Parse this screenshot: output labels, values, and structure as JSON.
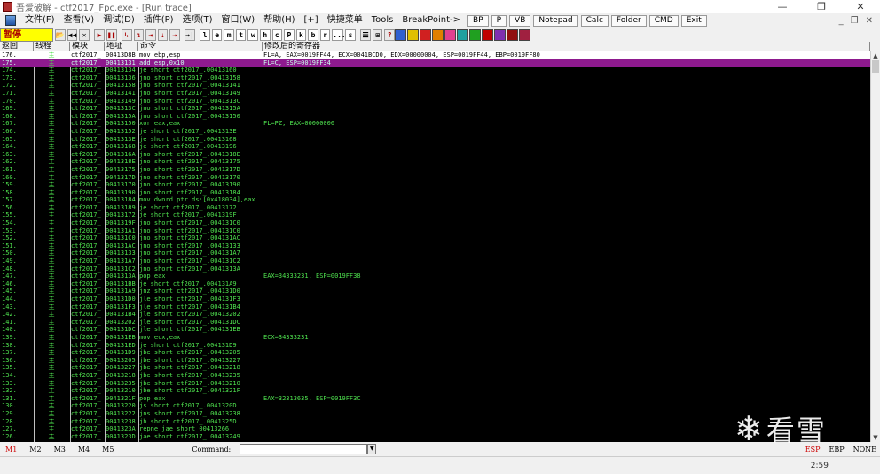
{
  "titlebar": {
    "title": "吾爱破解 - ctf2017_Fpc.exe - [Run trace]",
    "minimize": "—",
    "restore": "❐",
    "close": "✕"
  },
  "menu": {
    "items": [
      "文件(F)",
      "查看(V)",
      "调试(D)",
      "插件(P)",
      "选项(T)",
      "窗口(W)",
      "帮助(H)",
      "[+]",
      "快捷菜单",
      "Tools",
      "BreakPoint->"
    ],
    "buttons": [
      "BP",
      "P",
      "VB",
      "Notepad",
      "Calc",
      "Folder",
      "CMD",
      "Exit"
    ],
    "mdi": [
      "_",
      "❐",
      "✕"
    ]
  },
  "toolbar": {
    "status": "暂停",
    "buttons_left": [
      "📂",
      "◀◀",
      "✕",
      "▶",
      "❚❚",
      "↳",
      "↴",
      "⇥",
      "⇣",
      "⇢",
      "→|"
    ],
    "letters": [
      "l",
      "e",
      "m",
      "t",
      "w",
      "h",
      "c",
      "P",
      "k",
      "b",
      "r",
      "...",
      "s"
    ],
    "buttons_mid": [
      "☰",
      "⊞",
      "?"
    ],
    "color_icons": [
      {
        "name": "blue",
        "color": "#3060d0"
      },
      {
        "name": "yellow",
        "color": "#e0c000"
      },
      {
        "name": "red",
        "color": "#d02020"
      },
      {
        "name": "orange",
        "color": "#e08000"
      },
      {
        "name": "pink",
        "color": "#e04090"
      },
      {
        "name": "teal",
        "color": "#20a0a0"
      },
      {
        "name": "green",
        "color": "#20a020"
      },
      {
        "name": "red2",
        "color": "#c00000"
      },
      {
        "name": "purple",
        "color": "#8030b0"
      },
      {
        "name": "darkred",
        "color": "#901010"
      },
      {
        "name": "maroon",
        "color": "#a02040"
      }
    ]
  },
  "columns": [
    "返回",
    "线程",
    "模块",
    "地址",
    "命令",
    "修改后的寄存器"
  ],
  "trace_rows": [
    {
      "ret": "176.",
      "thr": "主",
      "mod": "ctf2017_",
      "addr": "00413D8B",
      "cmd": "mov ebp,esp",
      "reg": "FL=A, EAX=0019FF44, ECX=0041BCD0, EDX=00000004, ESP=0019FF44, EBP=0019FF80",
      "style": "sel"
    },
    {
      "ret": "175.",
      "thr": "主",
      "mod": "ctf2017_",
      "addr": "00413131",
      "cmd": "add esp,0x10",
      "reg": "FL=C, ESP=0019FF34",
      "style": "sel2"
    },
    {
      "ret": "174.",
      "thr": "主",
      "mod": "ctf2017_",
      "addr": "00413134",
      "cmd": "je short ctf2017_.00413160",
      "reg": ""
    },
    {
      "ret": "173.",
      "thr": "主",
      "mod": "ctf2017_",
      "addr": "00413136",
      "cmd": "jno short ctf2017_.00413158",
      "reg": ""
    },
    {
      "ret": "172.",
      "thr": "主",
      "mod": "ctf2017_",
      "addr": "00413158",
      "cmd": "jno short ctf2017_.00413141",
      "reg": ""
    },
    {
      "ret": "171.",
      "thr": "主",
      "mod": "ctf2017_",
      "addr": "00413141",
      "cmd": "jno short ctf2017_.00413149",
      "reg": ""
    },
    {
      "ret": "170.",
      "thr": "主",
      "mod": "ctf2017_",
      "addr": "00413149",
      "cmd": "jno short ctf2017_.0041313C",
      "reg": ""
    },
    {
      "ret": "169.",
      "thr": "主",
      "mod": "ctf2017_",
      "addr": "0041313C",
      "cmd": "jno short ctf2017_.0041315A",
      "reg": ""
    },
    {
      "ret": "168.",
      "thr": "主",
      "mod": "ctf2017_",
      "addr": "0041315A",
      "cmd": "jno short ctf2017_.00413150",
      "reg": ""
    },
    {
      "ret": "167.",
      "thr": "主",
      "mod": "ctf2017_",
      "addr": "00413150",
      "cmd": "xor eax,eax",
      "reg": "FL=PZ, EAX=00000000"
    },
    {
      "ret": "166.",
      "thr": "主",
      "mod": "ctf2017_",
      "addr": "00413152",
      "cmd": "je short ctf2017_.0041313E",
      "reg": ""
    },
    {
      "ret": "165.",
      "thr": "主",
      "mod": "ctf2017_",
      "addr": "0041313E",
      "cmd": "je short ctf2017_.00413168",
      "reg": ""
    },
    {
      "ret": "164.",
      "thr": "主",
      "mod": "ctf2017_",
      "addr": "00413168",
      "cmd": "je short ctf2017_.00413196",
      "reg": ""
    },
    {
      "ret": "163.",
      "thr": "主",
      "mod": "ctf2017_",
      "addr": "0041316A",
      "cmd": "jno short ctf2017_.0041318E",
      "reg": ""
    },
    {
      "ret": "162.",
      "thr": "主",
      "mod": "ctf2017_",
      "addr": "0041318E",
      "cmd": "jno short ctf2017_.00413175",
      "reg": ""
    },
    {
      "ret": "161.",
      "thr": "主",
      "mod": "ctf2017_",
      "addr": "00413175",
      "cmd": "jno short ctf2017_.0041317D",
      "reg": ""
    },
    {
      "ret": "160.",
      "thr": "主",
      "mod": "ctf2017_",
      "addr": "0041317D",
      "cmd": "jno short ctf2017_.00413170",
      "reg": ""
    },
    {
      "ret": "159.",
      "thr": "主",
      "mod": "ctf2017_",
      "addr": "00413170",
      "cmd": "jno short ctf2017_.00413190",
      "reg": ""
    },
    {
      "ret": "158.",
      "thr": "主",
      "mod": "ctf2017_",
      "addr": "00413190",
      "cmd": "jno short ctf2017_.00413184",
      "reg": ""
    },
    {
      "ret": "157.",
      "thr": "主",
      "mod": "ctf2017_",
      "addr": "00413184",
      "cmd": "mov dword ptr ds:[0x418034],eax",
      "reg": ""
    },
    {
      "ret": "156.",
      "thr": "主",
      "mod": "ctf2017_",
      "addr": "00413189",
      "cmd": "je short ctf2017_.00413172",
      "reg": ""
    },
    {
      "ret": "155.",
      "thr": "主",
      "mod": "ctf2017_",
      "addr": "00413172",
      "cmd": "je short ctf2017_.0041319F",
      "reg": ""
    },
    {
      "ret": "154.",
      "thr": "主",
      "mod": "ctf2017_",
      "addr": "0041319F",
      "cmd": "jno short ctf2017_.004131C0",
      "reg": ""
    },
    {
      "ret": "153.",
      "thr": "主",
      "mod": "ctf2017_",
      "addr": "004131A1",
      "cmd": "jno short ctf2017_.004131C0",
      "reg": ""
    },
    {
      "ret": "152.",
      "thr": "主",
      "mod": "ctf2017_",
      "addr": "004131C0",
      "cmd": "jno short ctf2017_.004131AC",
      "reg": ""
    },
    {
      "ret": "151.",
      "thr": "主",
      "mod": "ctf2017_",
      "addr": "004131AC",
      "cmd": "jno short ctf2017_.00413133",
      "reg": ""
    },
    {
      "ret": "150.",
      "thr": "主",
      "mod": "ctf2017_",
      "addr": "00413133",
      "cmd": "jno short ctf2017_.004131A7",
      "reg": ""
    },
    {
      "ret": "149.",
      "thr": "主",
      "mod": "ctf2017_",
      "addr": "004131A7",
      "cmd": "jno short ctf2017_.004131C2",
      "reg": ""
    },
    {
      "ret": "148.",
      "thr": "主",
      "mod": "ctf2017_",
      "addr": "004131C2",
      "cmd": "jno short ctf2017_.0041313A",
      "reg": ""
    },
    {
      "ret": "147.",
      "thr": "主",
      "mod": "ctf2017_",
      "addr": "0041313A",
      "cmd": "pop eax",
      "reg": "EAX=34333231, ESP=0019FF38"
    },
    {
      "ret": "146.",
      "thr": "主",
      "mod": "ctf2017_",
      "addr": "004131BB",
      "cmd": "je short ctf2017_.004131A9",
      "reg": ""
    },
    {
      "ret": "145.",
      "thr": "主",
      "mod": "ctf2017_",
      "addr": "004131A9",
      "cmd": "jnz short ctf2017_.004131D0",
      "reg": ""
    },
    {
      "ret": "144.",
      "thr": "主",
      "mod": "ctf2017_",
      "addr": "004131D0",
      "cmd": "jle short ctf2017_.004131F3",
      "reg": ""
    },
    {
      "ret": "143.",
      "thr": "主",
      "mod": "ctf2017_",
      "addr": "004131F3",
      "cmd": "jle short ctf2017_.004131B4",
      "reg": ""
    },
    {
      "ret": "142.",
      "thr": "主",
      "mod": "ctf2017_",
      "addr": "004131B4",
      "cmd": "jle short ctf2017_.00413202",
      "reg": ""
    },
    {
      "ret": "141.",
      "thr": "主",
      "mod": "ctf2017_",
      "addr": "00413202",
      "cmd": "jle short ctf2017_.004131DC",
      "reg": ""
    },
    {
      "ret": "140.",
      "thr": "主",
      "mod": "ctf2017_",
      "addr": "004131DC",
      "cmd": "jle short ctf2017_.004131EB",
      "reg": ""
    },
    {
      "ret": "139.",
      "thr": "主",
      "mod": "ctf2017_",
      "addr": "004131EB",
      "cmd": "mov ecx,eax",
      "reg": "ECX=34333231"
    },
    {
      "ret": "138.",
      "thr": "主",
      "mod": "ctf2017_",
      "addr": "004131ED",
      "cmd": "je short ctf2017_.004131D9",
      "reg": ""
    },
    {
      "ret": "137.",
      "thr": "主",
      "mod": "ctf2017_",
      "addr": "004131D9",
      "cmd": "jbe short ctf2017_.00413205",
      "reg": ""
    },
    {
      "ret": "136.",
      "thr": "主",
      "mod": "ctf2017_",
      "addr": "00413205",
      "cmd": "jbe short ctf2017_.00413227",
      "reg": ""
    },
    {
      "ret": "135.",
      "thr": "主",
      "mod": "ctf2017_",
      "addr": "00413227",
      "cmd": "jbe short ctf2017_.00413218",
      "reg": ""
    },
    {
      "ret": "134.",
      "thr": "主",
      "mod": "ctf2017_",
      "addr": "00413218",
      "cmd": "jbe short ctf2017_.00413235",
      "reg": ""
    },
    {
      "ret": "133.",
      "thr": "主",
      "mod": "ctf2017_",
      "addr": "00413235",
      "cmd": "jbe short ctf2017_.00413210",
      "reg": ""
    },
    {
      "ret": "132.",
      "thr": "主",
      "mod": "ctf2017_",
      "addr": "00413210",
      "cmd": "jbe short ctf2017_.0041321F",
      "reg": ""
    },
    {
      "ret": "131.",
      "thr": "主",
      "mod": "ctf2017_",
      "addr": "0041321F",
      "cmd": "pop eax",
      "reg": "EAX=32313635, ESP=0019FF3C"
    },
    {
      "ret": "130.",
      "thr": "主",
      "mod": "ctf2017_",
      "addr": "00413220",
      "cmd": "js short ctf2017_.0041320D",
      "reg": ""
    },
    {
      "ret": "129.",
      "thr": "主",
      "mod": "ctf2017_",
      "addr": "00413222",
      "cmd": "jns short ctf2017_.00413238",
      "reg": ""
    },
    {
      "ret": "128.",
      "thr": "主",
      "mod": "ctf2017_",
      "addr": "00413238",
      "cmd": "jb short ctf2017_.0041325D",
      "reg": ""
    },
    {
      "ret": "127.",
      "thr": "主",
      "mod": "ctf2017_",
      "addr": "0041323A",
      "cmd": "repne jae short 00413266",
      "reg": ""
    },
    {
      "ret": "126.",
      "thr": "主",
      "mod": "ctf2017_",
      "addr": "0041323D",
      "cmd": "jae short ctf2017_.00413249",
      "reg": ""
    }
  ],
  "cmdbar": {
    "marks": [
      "M1",
      "M2",
      "M3",
      "M4",
      "M5"
    ],
    "command_label": "Command:",
    "command_value": "",
    "flags": [
      "ESP",
      "EBP",
      "NONE"
    ]
  },
  "statusbar": {
    "clock": "2:59"
  },
  "watermark": {
    "flake": "❄",
    "text": "看雪"
  }
}
